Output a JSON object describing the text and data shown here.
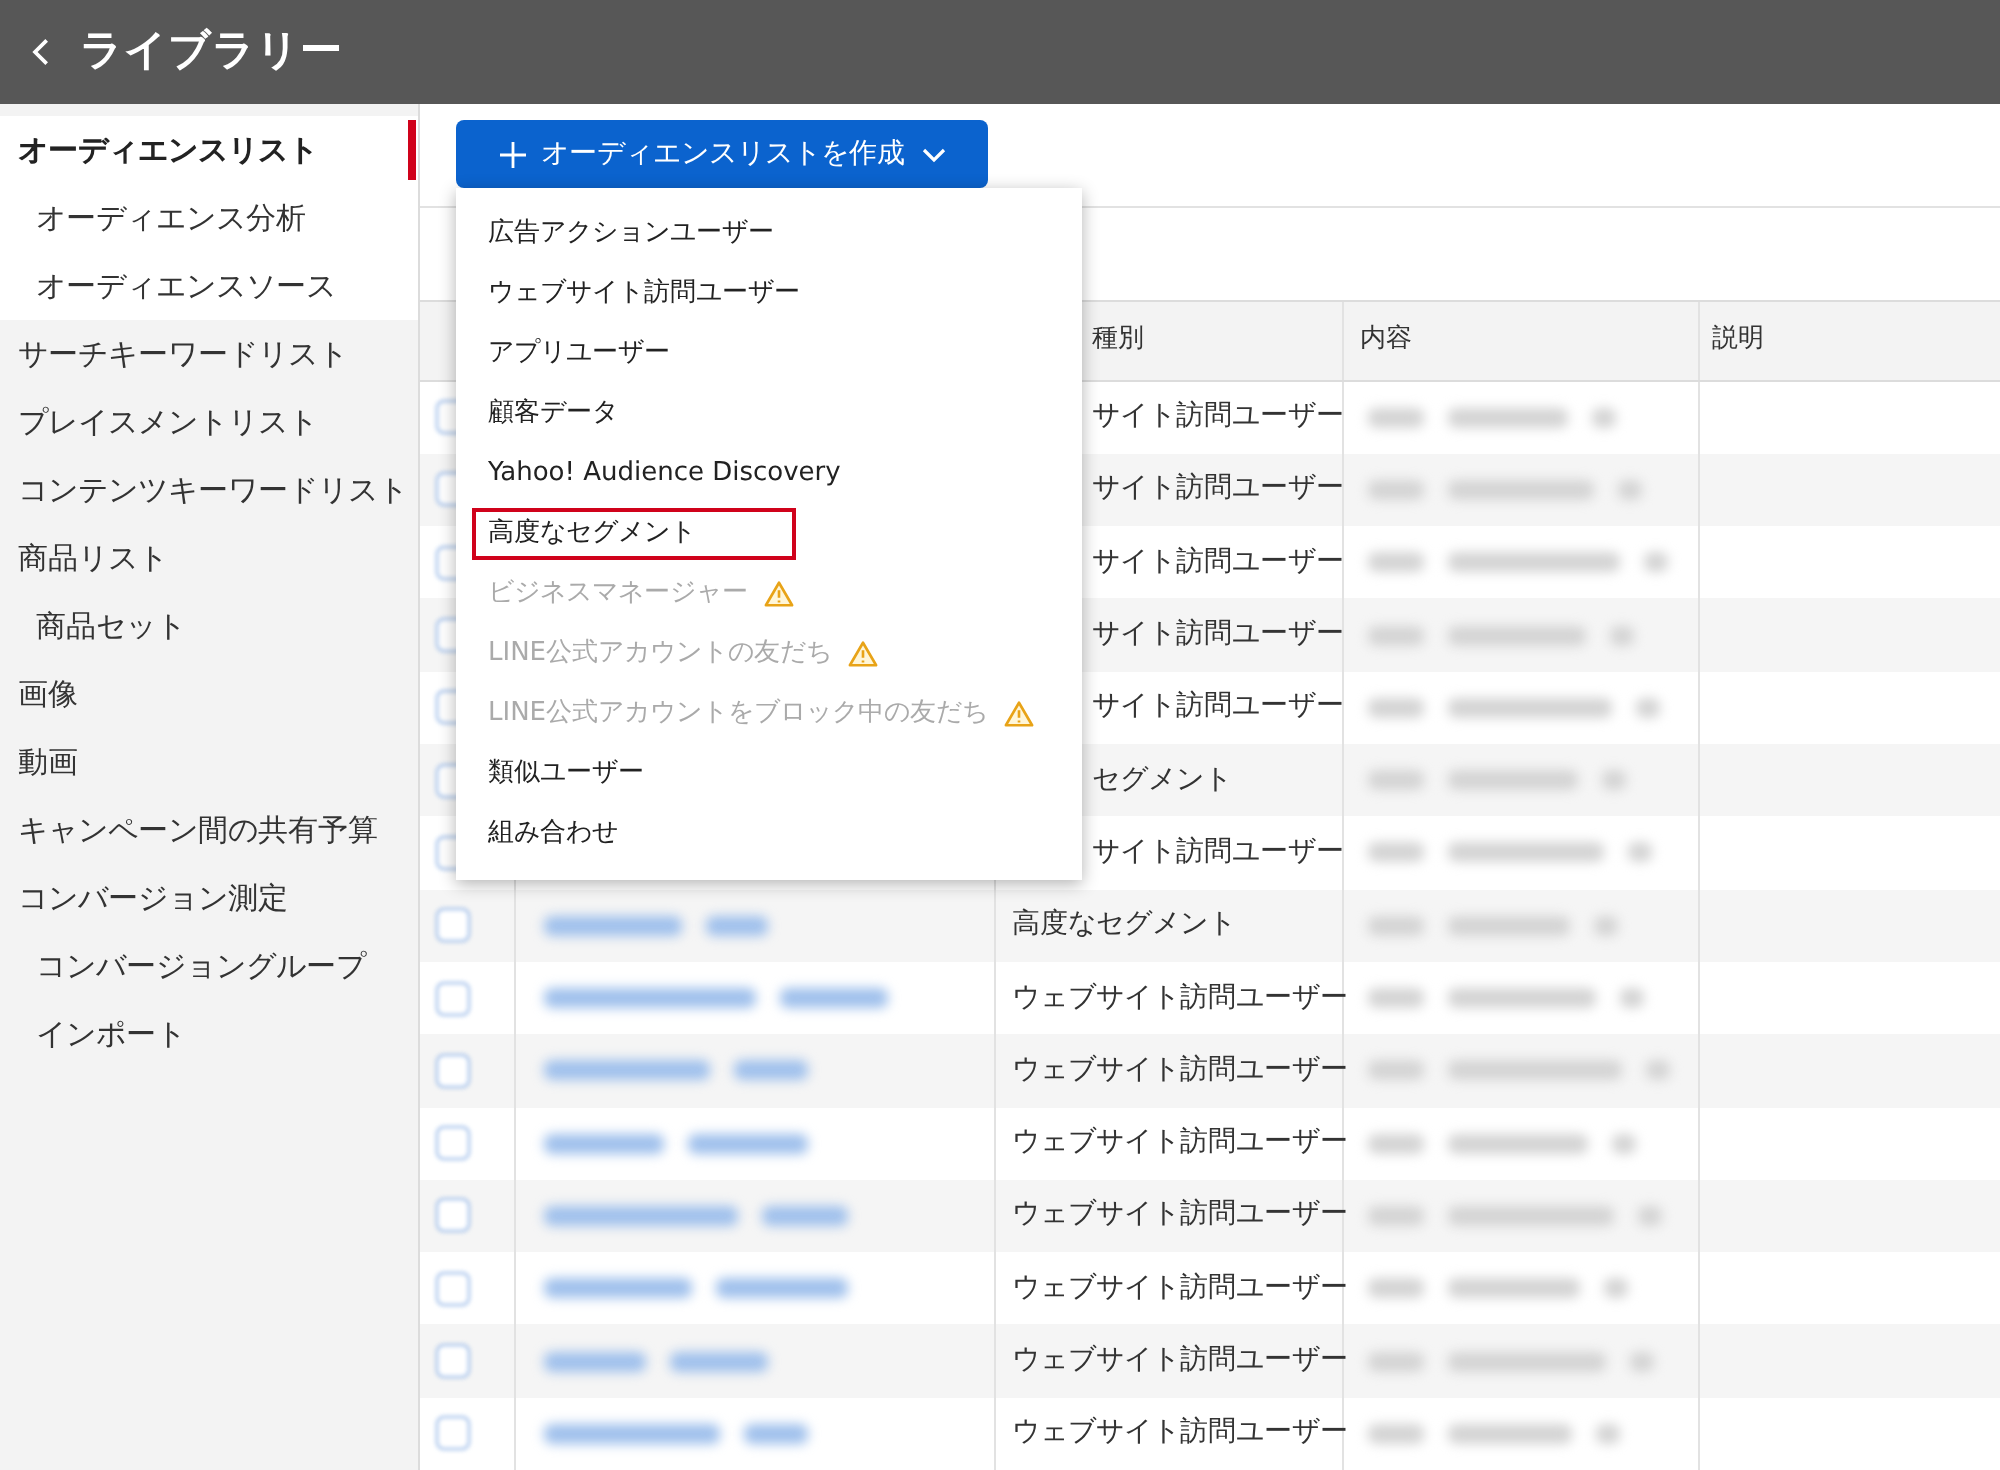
{
  "header": {
    "title": "ライブラリー"
  },
  "sidebar": {
    "items": [
      {
        "label": "オーディエンスリスト",
        "selected": true,
        "children": [
          {
            "label": "オーディエンス分析",
            "selected": false
          },
          {
            "label": "オーディエンスソース",
            "selected": false
          }
        ]
      },
      {
        "label": "サーチキーワードリスト",
        "selected": false
      },
      {
        "label": "プレイスメントリスト",
        "selected": false
      },
      {
        "label": "コンテンツキーワードリスト",
        "selected": false
      },
      {
        "label": "商品リスト",
        "selected": false,
        "children": [
          {
            "label": "商品セット",
            "selected": false
          }
        ]
      },
      {
        "label": "画像",
        "selected": false
      },
      {
        "label": "動画",
        "selected": false
      },
      {
        "label": "キャンペーン間の共有予算",
        "selected": false
      },
      {
        "label": "コンバージョン測定",
        "selected": false,
        "children": [
          {
            "label": "コンバージョングループ",
            "selected": false
          },
          {
            "label": "インポート",
            "selected": false
          }
        ]
      }
    ]
  },
  "create_button": {
    "label": "オーディエンスリストを作成",
    "expanded": true
  },
  "dropdown": {
    "items": [
      {
        "label": "広告アクションユーザー",
        "disabled": false,
        "warning": false,
        "highlighted": false
      },
      {
        "label": "ウェブサイト訪問ユーザー",
        "disabled": false,
        "warning": false,
        "highlighted": false
      },
      {
        "label": "アプリユーザー",
        "disabled": false,
        "warning": false,
        "highlighted": false
      },
      {
        "label": "顧客データ",
        "disabled": false,
        "warning": false,
        "highlighted": false
      },
      {
        "label": "Yahoo! Audience Discovery",
        "disabled": false,
        "warning": false,
        "highlighted": false
      },
      {
        "label": "高度なセグメント",
        "disabled": false,
        "warning": false,
        "highlighted": true
      },
      {
        "label": "ビジネスマネージャー",
        "disabled": true,
        "warning": true,
        "highlighted": false
      },
      {
        "label": "LINE公式アカウントの友だち",
        "disabled": true,
        "warning": true,
        "highlighted": false
      },
      {
        "label": "LINE公式アカウントをブロック中の友だち",
        "disabled": true,
        "warning": true,
        "highlighted": false
      },
      {
        "label": "類似ユーザー",
        "disabled": false,
        "warning": false,
        "highlighted": false
      },
      {
        "label": "組み合わせ",
        "disabled": false,
        "warning": false,
        "highlighted": false
      }
    ]
  },
  "table": {
    "columns": [
      "種別",
      "内容",
      "説明"
    ],
    "rows": [
      {
        "type": "サイト訪問ユーザー",
        "checked": false
      },
      {
        "type": "サイト訪問ユーザー",
        "checked": false
      },
      {
        "type": "サイト訪問ユーザー",
        "checked": false
      },
      {
        "type": "サイト訪問ユーザー",
        "checked": false
      },
      {
        "type": "サイト訪問ユーザー",
        "checked": false
      },
      {
        "type": "セグメント",
        "checked": false
      },
      {
        "type": "サイト訪問ユーザー",
        "checked": false
      },
      {
        "type": "高度なセグメント",
        "checked": false
      },
      {
        "type": "ウェブサイト訪問ユーザー",
        "checked": false
      },
      {
        "type": "ウェブサイト訪問ユーザー",
        "checked": false
      },
      {
        "type": "ウェブサイト訪問ユーザー",
        "checked": false
      },
      {
        "type": "ウェブサイト訪問ユーザー",
        "checked": false
      },
      {
        "type": "ウェブサイト訪問ユーザー",
        "checked": false
      },
      {
        "type": "ウェブサイト訪問ユーザー",
        "checked": false
      },
      {
        "type": "ウェブサイト訪問ユーザー",
        "checked": false
      }
    ]
  }
}
